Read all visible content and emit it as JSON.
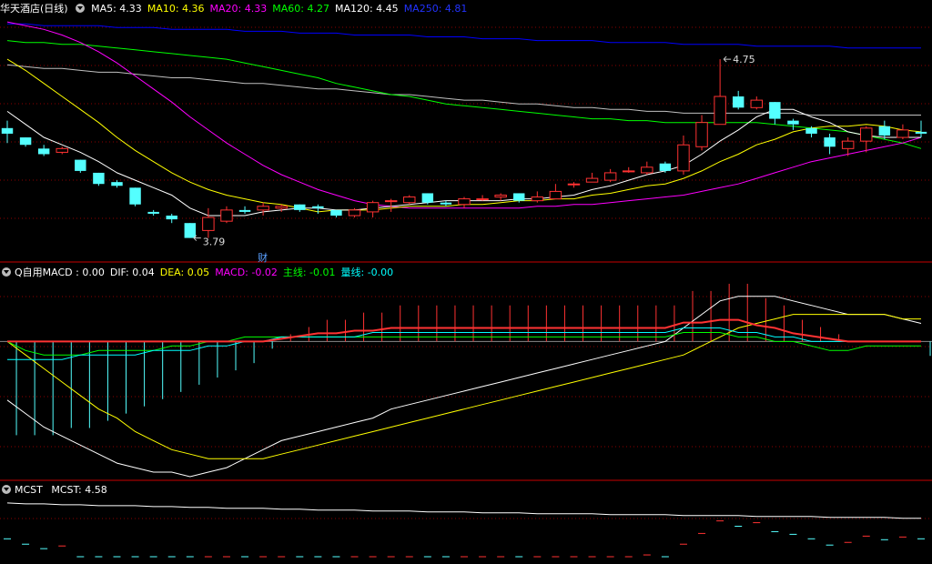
{
  "colors": {
    "bg": "#000000",
    "up": "#ff3232",
    "down": "#54ffff",
    "grid": "#8b0000",
    "ma5": "#ffffff",
    "ma10": "#ffff00",
    "ma20": "#ff00ff",
    "ma60": "#00ff00",
    "ma120": "#c0c0c0",
    "ma250": "#0000ff",
    "dif": "#ffffff",
    "dea": "#ffff00",
    "macd": "#ff00ff",
    "main_line": "#00ff00",
    "volume_line": "#00ffff",
    "separator": "#c80000"
  },
  "price_panel": {
    "title": "华天酒店(日线)",
    "legend": [
      {
        "label": "MA5: 4.33",
        "color": "#ffffff"
      },
      {
        "label": "MA10: 4.36",
        "color": "#ffff00"
      },
      {
        "label": "MA20: 4.33",
        "color": "#ff00ff"
      },
      {
        "label": "MA60: 4.27",
        "color": "#00ff00"
      },
      {
        "label": "MA120: 4.45",
        "color": "#ffffff"
      },
      {
        "label": "MA250: 4.81",
        "color": "#2233ff"
      }
    ],
    "high_label": "4.75",
    "low_label": "3.79",
    "event_marker": "财"
  },
  "macd_panel": {
    "title": "Q自用MACD",
    "legend": [
      {
        "label": ": 0.00",
        "color": "#ffffff"
      },
      {
        "label": "DIF: 0.04",
        "color": "#ffffff"
      },
      {
        "label": "DEA: 0.05",
        "color": "#ffff00"
      },
      {
        "label": "MACD: -0.02",
        "color": "#ff00ff"
      },
      {
        "label": "主线: -0.01",
        "color": "#00ff00"
      },
      {
        "label": "量线: -0.00",
        "color": "#00ffff"
      }
    ]
  },
  "mcst_panel": {
    "title": "MCST",
    "legend": [
      {
        "label": "MCST: 4.58",
        "color": "#ffffff"
      }
    ]
  },
  "chart_data": {
    "type": "candlestick",
    "price_range": [
      3.7,
      4.98
    ],
    "candles": [
      [
        4.38,
        4.35,
        4.42,
        4.3
      ],
      [
        4.33,
        4.29,
        4.33,
        4.28
      ],
      [
        4.27,
        4.24,
        4.29,
        4.23
      ],
      [
        4.25,
        4.27,
        4.28,
        4.24
      ],
      [
        4.21,
        4.15,
        4.21,
        4.14
      ],
      [
        4.14,
        4.08,
        4.14,
        4.07
      ],
      [
        4.09,
        4.07,
        4.1,
        4.06
      ],
      [
        4.06,
        3.97,
        4.06,
        3.96
      ],
      [
        3.93,
        3.92,
        3.94,
        3.91
      ],
      [
        3.91,
        3.89,
        3.92,
        3.87
      ],
      [
        3.87,
        3.79,
        3.87,
        3.79
      ],
      [
        3.83,
        3.9,
        3.95,
        3.79
      ],
      [
        3.88,
        3.94,
        3.96,
        3.87
      ],
      [
        3.94,
        3.93,
        3.96,
        3.92
      ],
      [
        3.94,
        3.96,
        3.98,
        3.91
      ],
      [
        3.95,
        3.96,
        3.97,
        3.93
      ],
      [
        3.97,
        3.94,
        3.97,
        3.93
      ],
      [
        3.96,
        3.95,
        3.97,
        3.92
      ],
      [
        3.94,
        3.91,
        3.94,
        3.9
      ],
      [
        3.91,
        3.94,
        3.95,
        3.9
      ],
      [
        3.93,
        3.98,
        3.99,
        3.9
      ],
      [
        3.99,
        3.99,
        4.0,
        3.93
      ],
      [
        3.98,
        4.01,
        4.02,
        3.97
      ],
      [
        4.03,
        3.98,
        4.03,
        3.97
      ],
      [
        3.98,
        3.97,
        3.99,
        3.96
      ],
      [
        3.97,
        4.0,
        4.01,
        3.95
      ],
      [
        4.0,
        4.0,
        4.02,
        3.99
      ],
      [
        4.01,
        4.02,
        4.03,
        3.99
      ],
      [
        4.03,
        3.99,
        4.03,
        3.98
      ],
      [
        3.99,
        4.01,
        4.04,
        3.98
      ],
      [
        4.0,
        4.04,
        4.08,
        4.0
      ],
      [
        4.08,
        4.08,
        4.09,
        4.06
      ],
      [
        4.09,
        4.11,
        4.14,
        4.09
      ],
      [
        4.1,
        4.14,
        4.16,
        4.09
      ],
      [
        4.15,
        4.15,
        4.17,
        4.14
      ],
      [
        4.14,
        4.17,
        4.2,
        4.13
      ],
      [
        4.19,
        4.15,
        4.2,
        4.14
      ],
      [
        4.15,
        4.29,
        4.34,
        4.13
      ],
      [
        4.28,
        4.41,
        4.45,
        4.26
      ],
      [
        4.4,
        4.55,
        4.75,
        4.4
      ],
      [
        4.55,
        4.49,
        4.58,
        4.48
      ],
      [
        4.49,
        4.53,
        4.55,
        4.48
      ],
      [
        4.52,
        4.43,
        4.52,
        4.4
      ],
      [
        4.42,
        4.4,
        4.43,
        4.37
      ],
      [
        4.38,
        4.35,
        4.39,
        4.33
      ],
      [
        4.33,
        4.28,
        4.35,
        4.24
      ],
      [
        4.27,
        4.31,
        4.33,
        4.23
      ],
      [
        4.31,
        4.38,
        4.39,
        4.25
      ],
      [
        4.39,
        4.34,
        4.42,
        4.32
      ],
      [
        4.33,
        4.37,
        4.4,
        4.32
      ],
      [
        4.36,
        4.35,
        4.42,
        4.33
      ]
    ],
    "ma5": [
      4.47,
      4.4,
      4.33,
      4.29,
      4.25,
      4.2,
      4.14,
      4.1,
      4.06,
      4.02,
      3.95,
      3.91,
      3.91,
      3.91,
      3.93,
      3.94,
      3.95,
      3.95,
      3.94,
      3.94,
      3.95,
      3.96,
      3.97,
      3.98,
      3.99,
      3.99,
      3.99,
      3.99,
      4.0,
      4.0,
      4.01,
      4.02,
      4.05,
      4.07,
      4.1,
      4.13,
      4.15,
      4.18,
      4.24,
      4.31,
      4.37,
      4.44,
      4.48,
      4.48,
      4.44,
      4.41,
      4.36,
      4.34,
      4.33,
      4.33,
      4.33
    ],
    "ma10": [
      4.75,
      4.69,
      4.62,
      4.55,
      4.48,
      4.41,
      4.33,
      4.26,
      4.2,
      4.14,
      4.09,
      4.05,
      4.02,
      4.0,
      3.98,
      3.97,
      3.95,
      3.93,
      3.94,
      3.94,
      3.94,
      3.95,
      3.96,
      3.96,
      3.96,
      3.97,
      3.97,
      3.98,
      3.99,
      3.99,
      4.0,
      4.0,
      4.02,
      4.03,
      4.05,
      4.07,
      4.08,
      4.11,
      4.15,
      4.2,
      4.24,
      4.29,
      4.32,
      4.36,
      4.38,
      4.39,
      4.39,
      4.4,
      4.39,
      4.37,
      4.36
    ],
    "ma20": [
      4.95,
      4.93,
      4.91,
      4.88,
      4.84,
      4.79,
      4.73,
      4.66,
      4.59,
      4.52,
      4.44,
      4.37,
      4.3,
      4.24,
      4.18,
      4.13,
      4.09,
      4.05,
      4.02,
      3.99,
      3.97,
      3.96,
      3.95,
      3.95,
      3.95,
      3.95,
      3.95,
      3.95,
      3.95,
      3.96,
      3.96,
      3.97,
      3.97,
      3.98,
      3.99,
      4.0,
      4.01,
      4.02,
      4.04,
      4.06,
      4.08,
      4.11,
      4.14,
      4.17,
      4.2,
      4.22,
      4.24,
      4.26,
      4.28,
      4.3,
      4.33
    ],
    "ma60": [
      4.85,
      4.84,
      4.84,
      4.83,
      4.83,
      4.82,
      4.81,
      4.8,
      4.79,
      4.78,
      4.77,
      4.76,
      4.75,
      4.73,
      4.71,
      4.69,
      4.67,
      4.65,
      4.62,
      4.6,
      4.58,
      4.56,
      4.55,
      4.53,
      4.51,
      4.5,
      4.49,
      4.48,
      4.47,
      4.46,
      4.45,
      4.44,
      4.43,
      4.43,
      4.42,
      4.42,
      4.41,
      4.41,
      4.41,
      4.41,
      4.41,
      4.41,
      4.4,
      4.39,
      4.38,
      4.37,
      4.36,
      4.34,
      4.32,
      4.3,
      4.27
    ],
    "ma120": [
      4.72,
      4.71,
      4.7,
      4.7,
      4.69,
      4.68,
      4.68,
      4.67,
      4.66,
      4.65,
      4.65,
      4.64,
      4.63,
      4.62,
      4.62,
      4.61,
      4.6,
      4.59,
      4.59,
      4.58,
      4.57,
      4.56,
      4.56,
      4.55,
      4.54,
      4.53,
      4.53,
      4.52,
      4.51,
      4.51,
      4.5,
      4.49,
      4.49,
      4.48,
      4.48,
      4.47,
      4.47,
      4.46,
      4.46,
      4.46,
      4.46,
      4.46,
      4.46,
      4.46,
      4.45,
      4.45,
      4.45,
      4.45,
      4.45,
      4.45,
      4.45
    ],
    "ma250": [
      4.94,
      4.94,
      4.93,
      4.93,
      4.93,
      4.93,
      4.92,
      4.92,
      4.92,
      4.91,
      4.91,
      4.91,
      4.91,
      4.9,
      4.9,
      4.9,
      4.89,
      4.89,
      4.89,
      4.88,
      4.88,
      4.88,
      4.88,
      4.87,
      4.87,
      4.87,
      4.86,
      4.86,
      4.86,
      4.85,
      4.85,
      4.85,
      4.85,
      4.84,
      4.84,
      4.84,
      4.84,
      4.83,
      4.83,
      4.83,
      4.83,
      4.82,
      4.82,
      4.82,
      4.82,
      4.82,
      4.81,
      4.81,
      4.81,
      4.81,
      4.81
    ],
    "macd_range": [
      -0.3,
      0.14
    ],
    "dif": [
      -0.13,
      -0.16,
      -0.19,
      -0.21,
      -0.23,
      -0.25,
      -0.27,
      -0.28,
      -0.29,
      -0.29,
      -0.3,
      -0.29,
      -0.28,
      -0.26,
      -0.24,
      -0.22,
      -0.21,
      -0.2,
      -0.19,
      -0.18,
      -0.17,
      -0.15,
      -0.14,
      -0.13,
      -0.12,
      -0.11,
      -0.1,
      -0.09,
      -0.08,
      -0.07,
      -0.06,
      -0.05,
      -0.04,
      -0.03,
      -0.02,
      -0.01,
      0.0,
      0.03,
      0.06,
      0.09,
      0.1,
      0.1,
      0.1,
      0.09,
      0.08,
      0.07,
      0.06,
      0.06,
      0.06,
      0.05,
      0.04
    ],
    "dea": [
      -0.0,
      -0.03,
      -0.06,
      -0.09,
      -0.12,
      -0.15,
      -0.17,
      -0.2,
      -0.22,
      -0.24,
      -0.25,
      -0.26,
      -0.26,
      -0.26,
      -0.26,
      -0.25,
      -0.24,
      -0.23,
      -0.22,
      -0.21,
      -0.2,
      -0.19,
      -0.18,
      -0.17,
      -0.16,
      -0.15,
      -0.14,
      -0.13,
      -0.12,
      -0.11,
      -0.1,
      -0.09,
      -0.08,
      -0.07,
      -0.06,
      -0.05,
      -0.04,
      -0.03,
      -0.01,
      0.01,
      0.03,
      0.04,
      0.05,
      0.06,
      0.06,
      0.06,
      0.06,
      0.06,
      0.06,
      0.05,
      0.05
    ],
    "macd": [
      -0.13,
      -0.13,
      -0.13,
      -0.12,
      -0.12,
      -0.11,
      -0.1,
      -0.09,
      -0.08,
      -0.07,
      -0.06,
      -0.05,
      -0.04,
      -0.03,
      -0.01,
      0.01,
      0.02,
      0.03,
      0.03,
      0.04,
      0.04,
      0.05,
      0.05,
      0.05,
      0.05,
      0.05,
      0.05,
      0.05,
      0.05,
      0.05,
      0.05,
      0.05,
      0.05,
      0.05,
      0.05,
      0.05,
      0.05,
      0.07,
      0.07,
      0.08,
      0.08,
      0.06,
      0.05,
      0.03,
      0.02,
      0.01,
      0.0,
      0.0,
      0.0,
      0.0,
      -0.02
    ],
    "main_line": [
      -0.0,
      -0.02,
      -0.03,
      -0.03,
      -0.03,
      -0.02,
      -0.02,
      -0.02,
      -0.02,
      -0.01,
      -0.01,
      0.0,
      0.0,
      0.01,
      0.01,
      0.01,
      0.01,
      0.01,
      0.01,
      0.01,
      0.01,
      0.01,
      0.01,
      0.01,
      0.01,
      0.01,
      0.01,
      0.01,
      0.01,
      0.01,
      0.01,
      0.01,
      0.01,
      0.01,
      0.01,
      0.01,
      0.01,
      0.02,
      0.02,
      0.02,
      0.01,
      0.01,
      0.0,
      -0.0,
      -0.01,
      -0.02,
      -0.02,
      -0.01,
      -0.01,
      -0.01,
      -0.01
    ],
    "volume_line": [
      -0.04,
      -0.04,
      -0.04,
      -0.04,
      -0.03,
      -0.03,
      -0.03,
      -0.03,
      -0.02,
      -0.02,
      -0.02,
      -0.01,
      -0.01,
      -0.0,
      0.0,
      0.01,
      0.01,
      0.01,
      0.01,
      0.01,
      0.02,
      0.02,
      0.02,
      0.02,
      0.02,
      0.02,
      0.02,
      0.02,
      0.02,
      0.02,
      0.02,
      0.02,
      0.02,
      0.02,
      0.02,
      0.02,
      0.02,
      0.03,
      0.03,
      0.03,
      0.02,
      0.02,
      0.01,
      0.01,
      0.0,
      -0.0,
      -0.0,
      -0.0,
      -0.0,
      -0.0,
      -0.0
    ],
    "mcst_range": [
      4.15,
      4.8
    ],
    "mcst": [
      4.75,
      4.74,
      4.74,
      4.73,
      4.73,
      4.72,
      4.72,
      4.72,
      4.71,
      4.71,
      4.7,
      4.7,
      4.69,
      4.69,
      4.69,
      4.68,
      4.68,
      4.67,
      4.67,
      4.67,
      4.66,
      4.66,
      4.66,
      4.65,
      4.65,
      4.65,
      4.64,
      4.64,
      4.64,
      4.63,
      4.63,
      4.63,
      4.63,
      4.62,
      4.62,
      4.62,
      4.62,
      4.61,
      4.61,
      4.61,
      4.61,
      4.6,
      4.6,
      4.6,
      4.6,
      4.59,
      4.59,
      4.59,
      4.59,
      4.58,
      4.58
    ]
  }
}
